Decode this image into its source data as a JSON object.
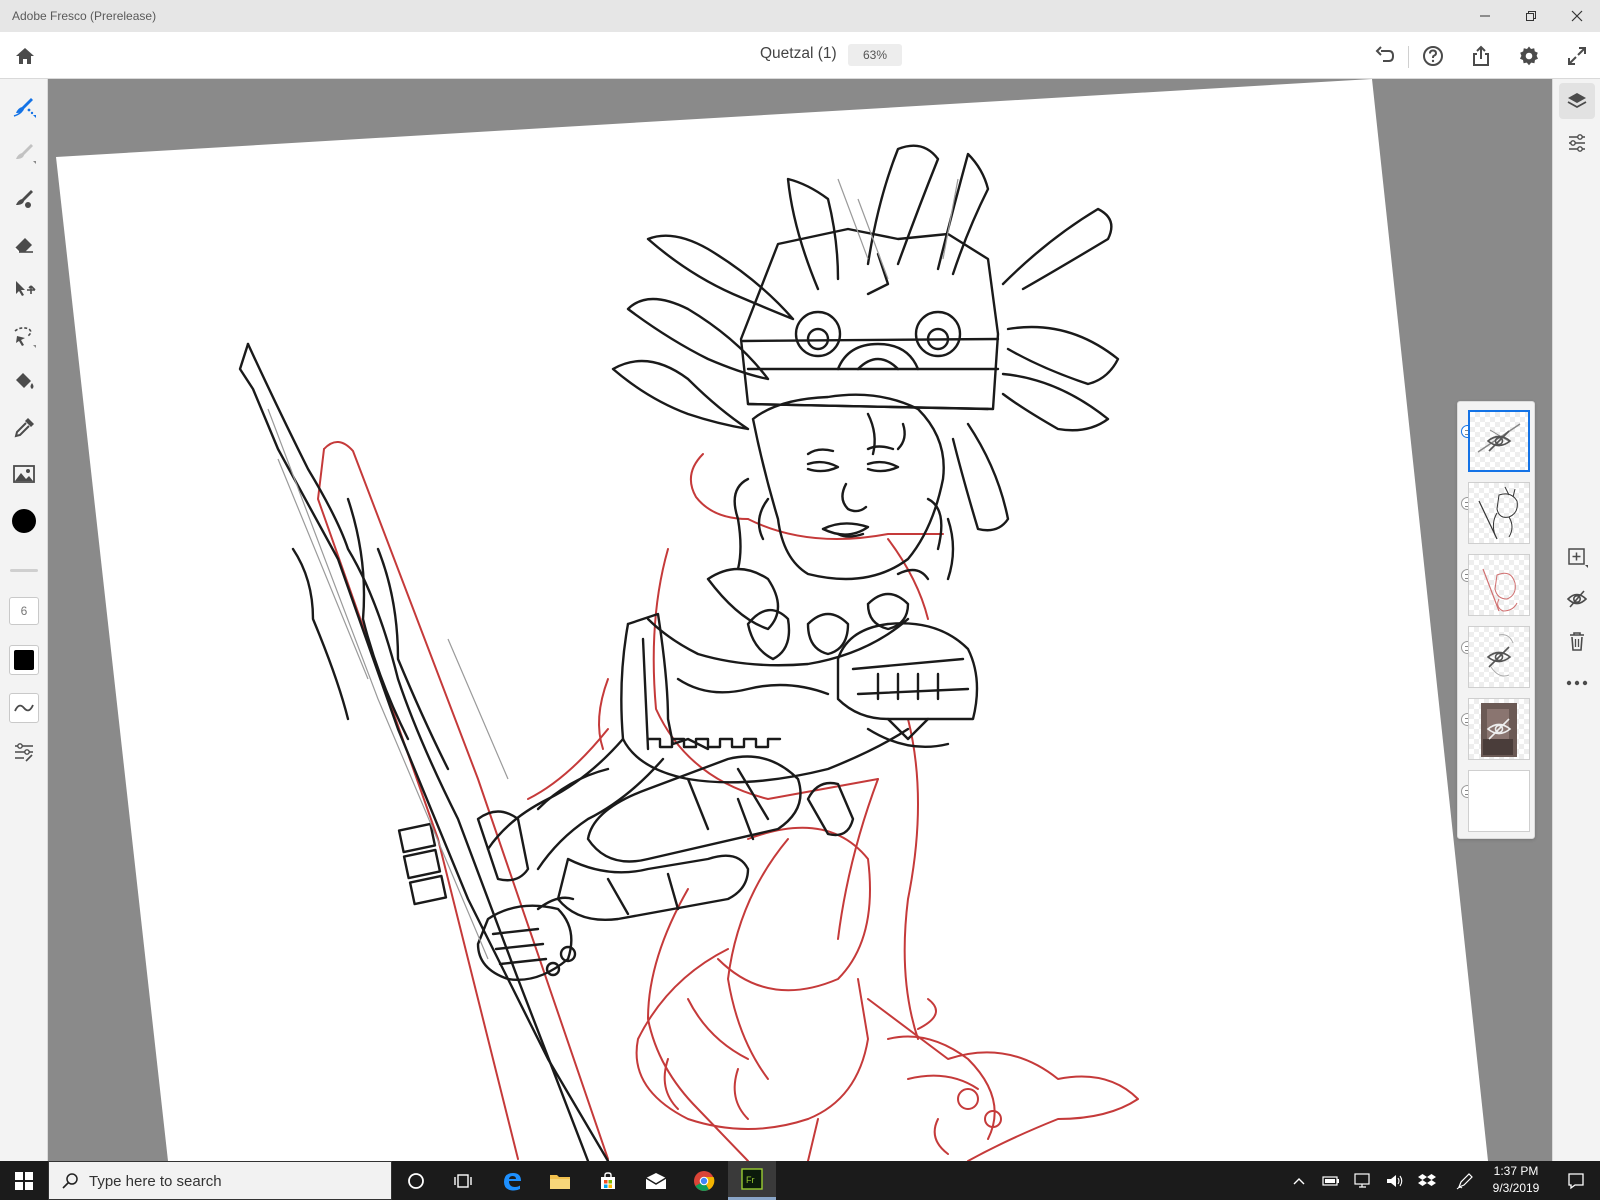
{
  "window": {
    "app_title": "Adobe Fresco (Prerelease)"
  },
  "toolbar": {
    "document_title": "Quetzal (1)",
    "zoom": "63%"
  },
  "tools": {
    "brush_size": "6",
    "current_color": "#000000",
    "accent": "#1473e6"
  },
  "tool_items": [
    {
      "name": "live-brush-tool",
      "selected": true
    },
    {
      "name": "watercolor-brush-tool"
    },
    {
      "name": "pixel-brush-tool"
    },
    {
      "name": "eraser-tool"
    },
    {
      "name": "transform-tool"
    },
    {
      "name": "lasso-selection-tool"
    },
    {
      "name": "fill-tool"
    },
    {
      "name": "eyedropper-tool"
    },
    {
      "name": "place-image-tool"
    },
    {
      "name": "color-picker"
    }
  ],
  "layers": [
    {
      "name": "layer-1",
      "selected": true,
      "hidden": true
    },
    {
      "name": "layer-2",
      "selected": false,
      "hidden": false
    },
    {
      "name": "layer-3",
      "selected": false,
      "hidden": false
    },
    {
      "name": "layer-4",
      "selected": false,
      "hidden": true
    },
    {
      "name": "layer-5",
      "selected": false,
      "hidden": true
    },
    {
      "name": "layer-6",
      "selected": false,
      "hidden": false
    }
  ],
  "taskbar": {
    "search_placeholder": "Type here to search",
    "time": "1:37 PM",
    "date": "9/3/2019"
  }
}
